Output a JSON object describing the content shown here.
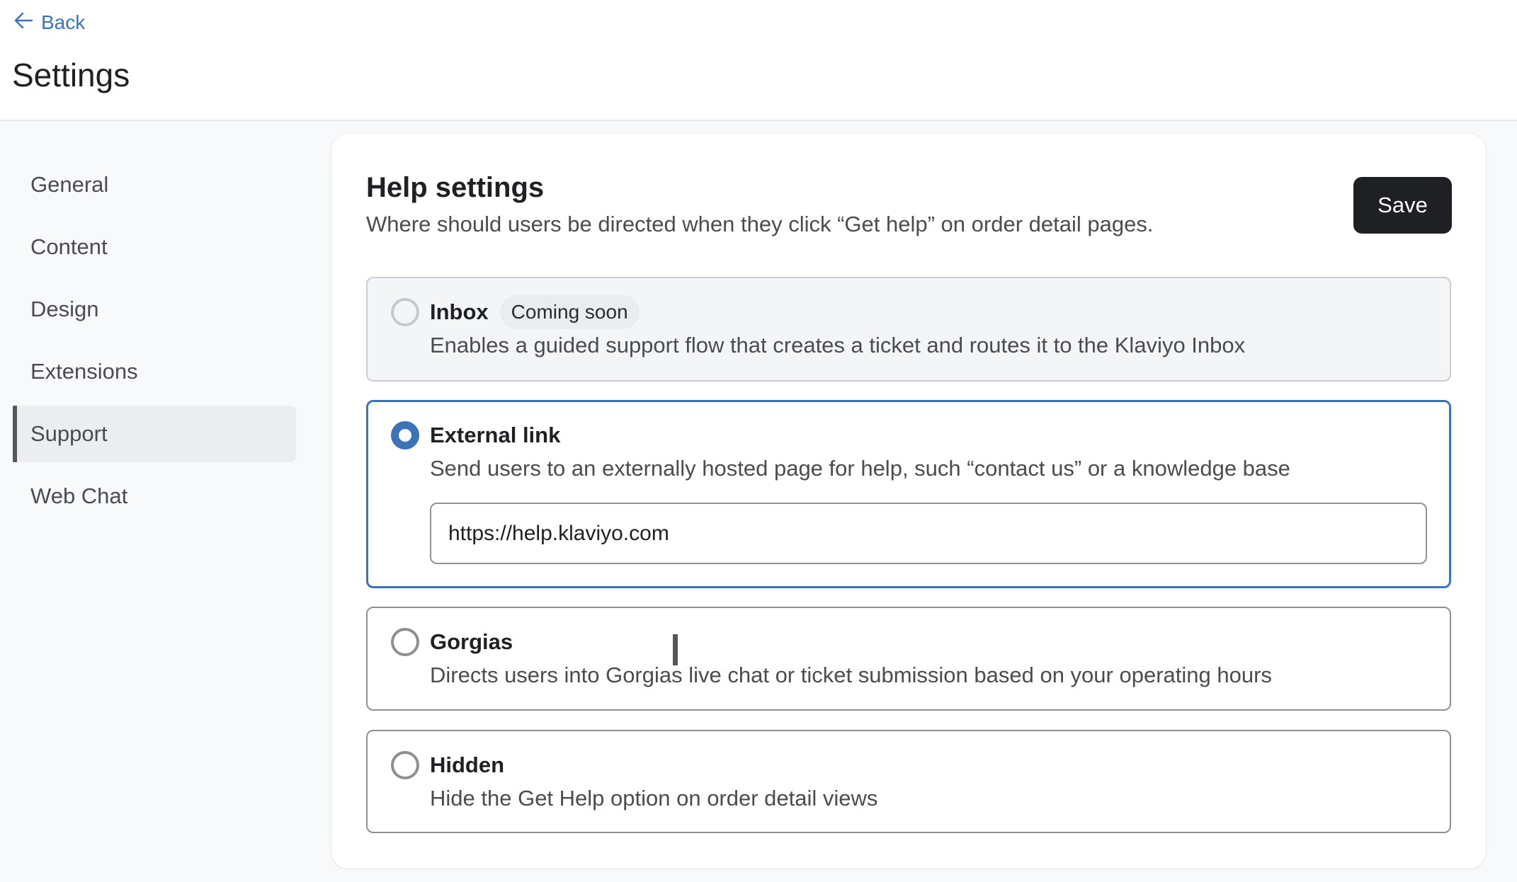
{
  "header": {
    "back_label": "Back",
    "back_icon": "arrow-left-icon",
    "page_title": "Settings"
  },
  "sidebar": {
    "items": [
      {
        "label": "General",
        "active": false
      },
      {
        "label": "Content",
        "active": false
      },
      {
        "label": "Design",
        "active": false
      },
      {
        "label": "Extensions",
        "active": false
      },
      {
        "label": "Support",
        "active": true
      },
      {
        "label": "Web Chat",
        "active": false
      }
    ]
  },
  "help_settings": {
    "title": "Help settings",
    "subtitle": "Where should users be directed when they click “Get help” on order detail pages.",
    "save_label": "Save",
    "selected_option": "External link",
    "options": [
      {
        "title": "Inbox",
        "badge": "Coming soon",
        "description": "Enables a guided support flow that creates a ticket and routes it to the Klaviyo Inbox",
        "selected": false,
        "disabled": true
      },
      {
        "title": "External link",
        "description": "Send users to an externally hosted page for help, such “contact us” or a knowledge base",
        "selected": true,
        "disabled": false,
        "input_value": "https://help.klaviyo.com"
      },
      {
        "title": "Gorgias",
        "description": "Directs users into Gorgias live chat or ticket submission based on your operating hours",
        "selected": false,
        "disabled": false
      },
      {
        "title": "Hidden",
        "description": "Hide the Get Help option on order detail views",
        "selected": false,
        "disabled": false
      }
    ]
  },
  "colors": {
    "accent": "#3b73b9",
    "link": "#3c74b9",
    "primary_button": "#1f2023",
    "page_background": "#f8f9fb"
  }
}
